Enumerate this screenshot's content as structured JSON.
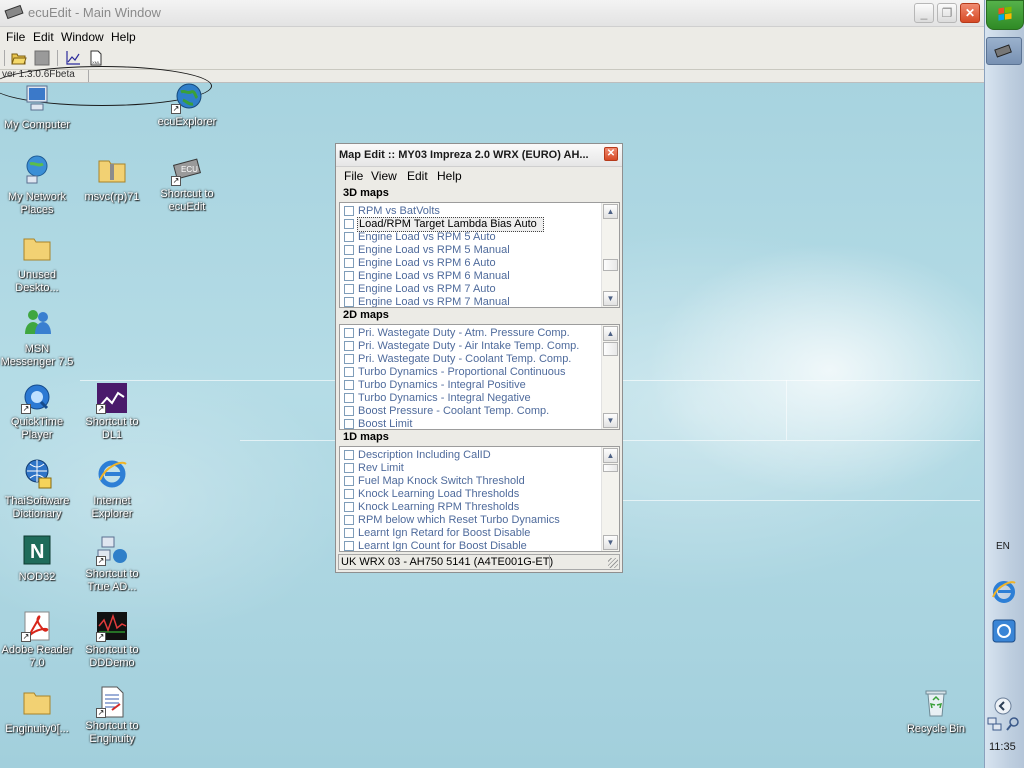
{
  "app": {
    "title": "ecuEdit - Main Window",
    "menu": [
      "File",
      "Edit",
      "Window",
      "Help"
    ],
    "version_text": "ver 1.3.0.6Fbeta"
  },
  "desktop_icons": [
    {
      "label": "My Computer",
      "icon": "my-computer-icon"
    },
    {
      "label": "ecuExplorer",
      "icon": "ecuexplorer-globe-icon"
    },
    {
      "label": "My Network Places",
      "icon": "network-places-icon"
    },
    {
      "label": "msvc(rp)71",
      "icon": "folder-zip-icon"
    },
    {
      "label": "Shortcut to ecuEdit",
      "icon": "ecu-chip-icon"
    },
    {
      "label": "Unused Deskto...",
      "icon": "folder-icon"
    },
    {
      "label": "MSN Messenger 7.5",
      "icon": "msn-messenger-icon"
    },
    {
      "label": "QuickTime Player",
      "icon": "quicktime-icon"
    },
    {
      "label": "Shortcut to DL1",
      "icon": "dl1-chart-icon"
    },
    {
      "label": "ThaiSoftware Dictionary",
      "icon": "dictionary-globe-icon"
    },
    {
      "label": "Internet Explorer",
      "icon": "internet-explorer-icon"
    },
    {
      "label": "NOD32",
      "icon": "nod32-icon"
    },
    {
      "label": "Shortcut to True AD...",
      "icon": "network-tool-icon"
    },
    {
      "label": "Adobe Reader 7.0",
      "icon": "adobe-reader-icon"
    },
    {
      "label": "Shortcut to DDDemo",
      "icon": "oscilloscope-icon"
    },
    {
      "label": "Enginuity0[...",
      "icon": "folder-icon"
    },
    {
      "label": "Shortcut to Enginuity",
      "icon": "document-icon"
    },
    {
      "label": "Recycle Bin",
      "icon": "recycle-bin-icon"
    }
  ],
  "map_edit": {
    "title": "Map Edit :: MY03 Impreza 2.0 WRX (EURO) AH...",
    "menu": [
      "File",
      "View",
      "Edit",
      "Help"
    ],
    "sections": [
      {
        "heading": "3D maps",
        "items": [
          "RPM vs BatVolts",
          "Load/RPM Target Lambda Bias Auto",
          "Engine Load vs RPM 5 Auto",
          "Engine Load vs RPM 5 Manual",
          "Engine Load vs RPM 6 Auto",
          "Engine Load vs RPM 6 Manual",
          "Engine Load vs RPM 7 Auto",
          "Engine Load vs RPM 7 Manual"
        ],
        "selected_item": "Load/RPM Target Lambda Bias Auto"
      },
      {
        "heading": "2D maps",
        "items": [
          "Pri. Wastegate Duty - Atm. Pressure Comp.",
          "Pri. Wastegate Duty - Air Intake Temp. Comp.",
          "Pri. Wastegate Duty - Coolant Temp. Comp.",
          "Turbo Dynamics - Proportional Continuous",
          "Turbo Dynamics - Integral Positive",
          "Turbo Dynamics - Integral Negative",
          "Boost Pressure - Coolant Temp. Comp.",
          "Boost Limit"
        ]
      },
      {
        "heading": "1D maps",
        "items": [
          "Description Including CalID",
          "Rev Limit",
          "Fuel Map Knock Switch Threshold",
          "Knock Learning Load Thresholds",
          "Knock Learning RPM Thresholds",
          "RPM below which Reset Turbo Dynamics",
          "Learnt Ign Retard for Boost Disable",
          "Learnt Ign Count for Boost Disable"
        ]
      }
    ],
    "status": "UK WRX 03 - AH750 5141 (A4TE001G-ET)"
  },
  "taskbar": {
    "language": "EN",
    "clock": "11:35"
  }
}
